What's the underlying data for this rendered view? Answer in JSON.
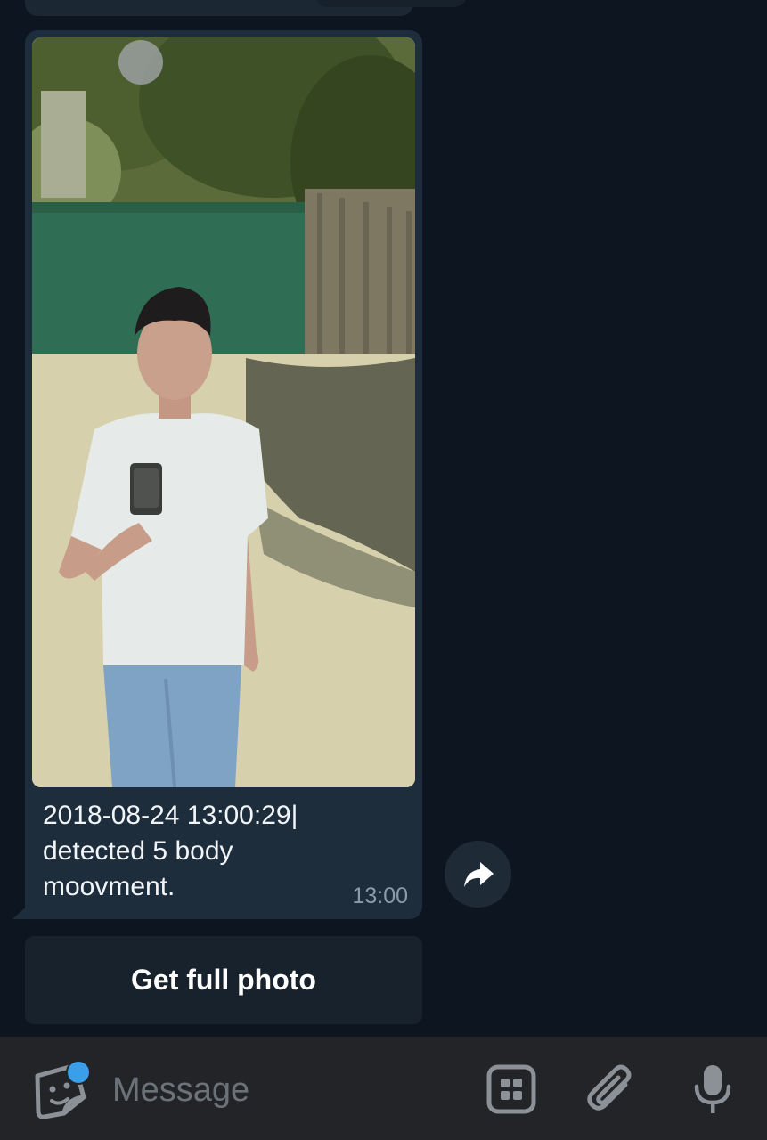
{
  "conversation": {
    "message": {
      "caption": "2018-08-24 13:00:29|\ndetected 5 body\nmoovment.",
      "time": "13:00",
      "photo_icon": "photo-thumbnail"
    },
    "share_icon": "share-forward-icon",
    "inline_button": {
      "label": "Get full photo"
    }
  },
  "input_bar": {
    "placeholder": "Message",
    "value": "",
    "icons": {
      "sticker": "sticker-icon",
      "bot_commands": "bot-commands-icon",
      "attach": "paperclip-icon",
      "voice": "microphone-icon"
    },
    "badge_color": "#3a9ee8"
  },
  "colors": {
    "background": "#0d1620",
    "bubble": "#1d2d3c",
    "inline_button": "#18222d",
    "input_bar": "#222428"
  }
}
